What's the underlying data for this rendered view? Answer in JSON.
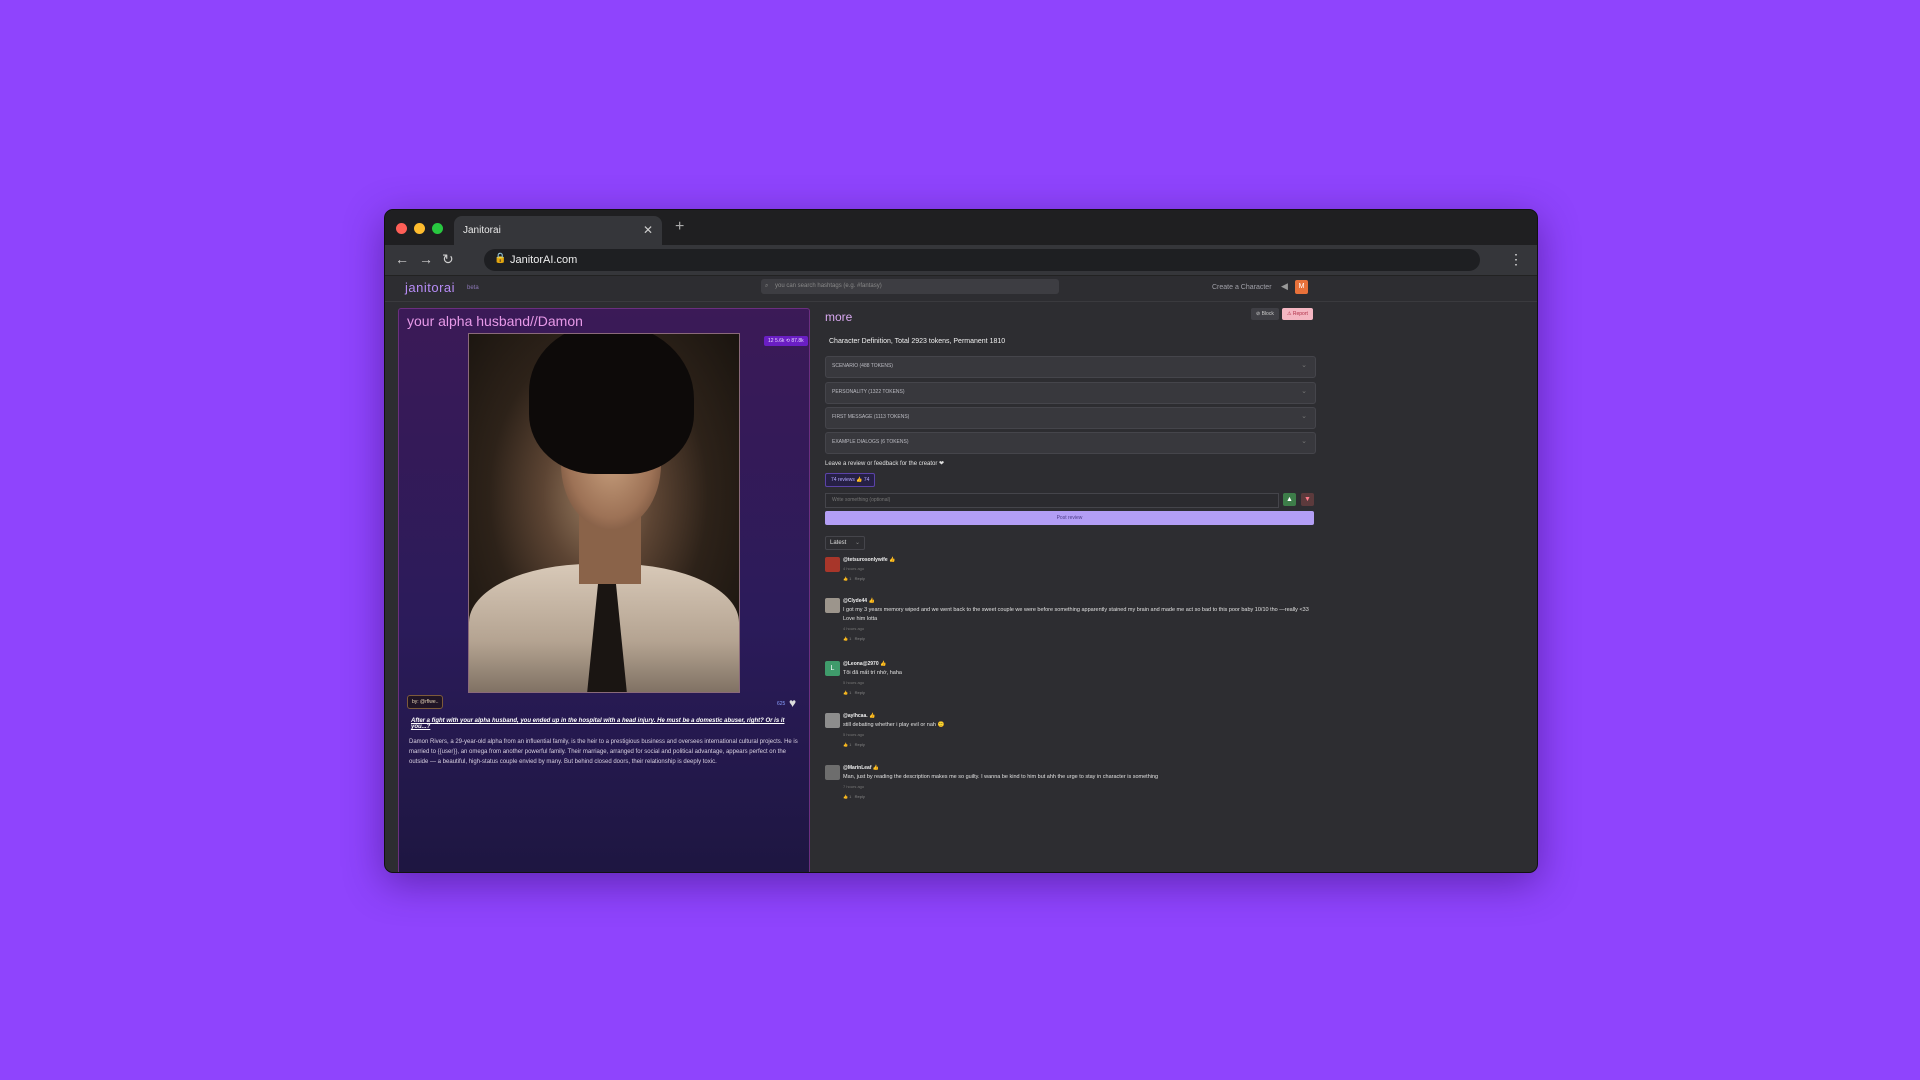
{
  "browser": {
    "tab_title": "Janitorai",
    "url": "JanitorAI.com"
  },
  "site": {
    "logo": "janitorai",
    "logo_badge": "beta",
    "search_placeholder": "you can search hashtags (e.g. #fantasy)",
    "create_character": "Create a Character",
    "user_avatar_initial": "M"
  },
  "character": {
    "title": "your alpha husband//Damon",
    "stats": "12 5.6k ⟲ 87.8k",
    "byline": "by: @rflwe..",
    "likes": "625",
    "tagline": "After a fight with your alpha husband, you ended up in the hospital with a head injury. He must be a domestic abuser, right? Or is it you...?",
    "description": "Damon Rivers, a 29-year-old alpha from an influential family, is the heir to a prestigious business and oversees international cultural projects. He is married to {{user}}, an omega from another powerful family. Their marriage, arranged for social and political advantage, appears perfect on the outside — a beautiful, high-status couple envied by many. But behind closed doors, their relationship is deeply toxic."
  },
  "details": {
    "section_title": "more",
    "block_label": "Block",
    "report_label": "Report",
    "definition_summary": "Character Definition, Total 2923 tokens, Permanent 1810",
    "accordions": [
      {
        "label": "SCENARIO (488 TOKENS)"
      },
      {
        "label": "PERSONALITY (1322 TOKENS)"
      },
      {
        "label": "FIRST MESSAGE (1113 TOKENS)"
      },
      {
        "label": "EXAMPLE DIALOGS (6 TOKENS)"
      }
    ]
  },
  "reviews": {
    "prompt": "Leave a review or feedback for the creator ❤",
    "count_label": "74 reviews 👍 74",
    "input_placeholder": "Write something (optional)",
    "post_label": "Post review",
    "sort_label": "Latest",
    "comments": [
      {
        "user": "@tetsurosonlywife 👍",
        "text": "",
        "time": "4 hours ago",
        "likes": "1",
        "reply": "Reply",
        "avatar_color": "#a8362a"
      },
      {
        "user": "@Clyde44 👍",
        "text": "I got my 3 years memory wiped and we went back to the sweet couple we were before something apparently stained my brain and made me act so bad to this poor baby 10/10 tho —really <33 Love him lotta",
        "time": "4 hours ago",
        "likes": "1",
        "reply": "Reply",
        "avatar_color": "#9c958c"
      },
      {
        "user": "@Leona@2970 👍",
        "text": "Tôi đã mất trí nhớ, haha",
        "time": "5 hours ago",
        "likes": "1",
        "reply": "Reply",
        "avatar_color": "#3f9b6b",
        "avatar_letter": "L"
      },
      {
        "user": "@aylhcaa. 👍",
        "text": "still debating whether i play evil or nah 🙁",
        "time": "5 hours ago",
        "likes": "1",
        "reply": "Reply",
        "avatar_color": "#8d8d8d"
      },
      {
        "user": "@MarinLeaf 👍",
        "text": "Man, just by reading the description makes me so guilty. I wanna be kind to him but ahh the urge to stay in character is something",
        "time": "7 hours ago",
        "likes": "1",
        "reply": "Reply",
        "avatar_color": "#6d6d6d"
      }
    ]
  }
}
